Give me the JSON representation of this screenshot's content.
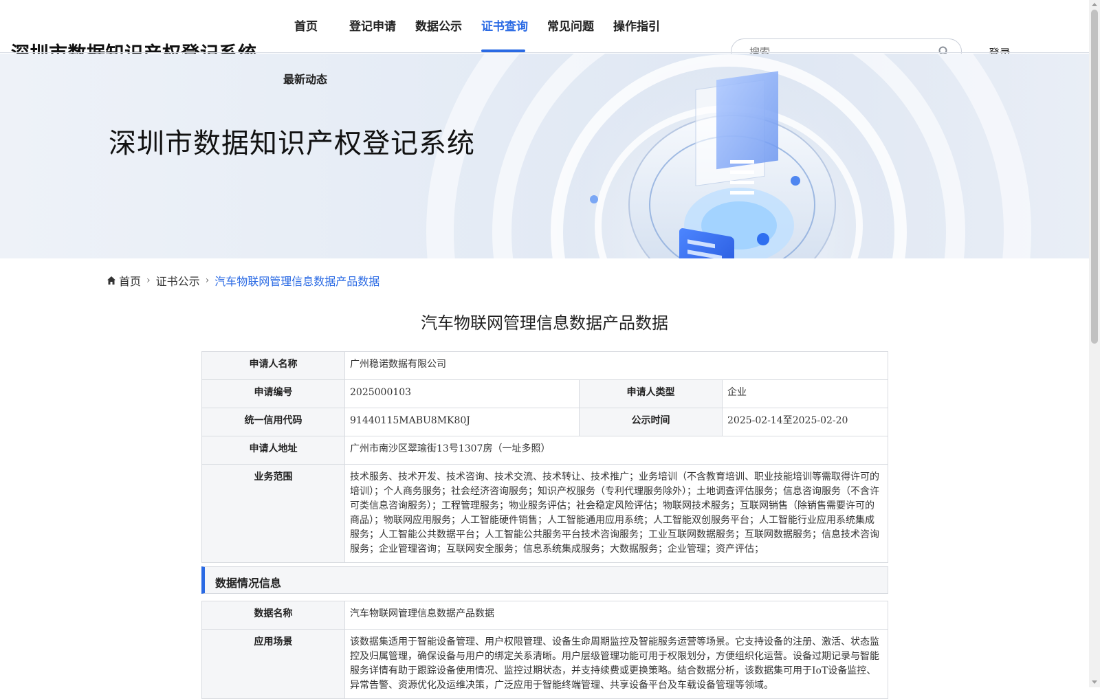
{
  "header": {
    "site_title": "深圳市数据知识产权登记系统",
    "nav": [
      {
        "label": "首页"
      },
      {
        "label": "登记申请"
      },
      {
        "label": "数据公示"
      },
      {
        "label": "证书查询"
      },
      {
        "label": "常见问题"
      },
      {
        "label": "操作指引"
      }
    ],
    "nav_row2": "最新动态",
    "active_nav": "证书查询",
    "search_placeholder": "搜索",
    "login_label": "登录"
  },
  "banner": {
    "title": "深圳市数据知识产权登记系统"
  },
  "breadcrumb": {
    "home": "首页",
    "level2": "证书公示",
    "current": "汽车物联网管理信息数据产品数据"
  },
  "page_title": "汽车物联网管理信息数据产品数据",
  "applicant": {
    "name_label": "申请人名称",
    "name": "广州稳诺数据有限公司",
    "app_no_label": "申请编号",
    "app_no": "2025000103",
    "type_label": "申请人类型",
    "type": "企业",
    "credit_code_label": "统一信用代码",
    "credit_code": "91440115MABU8MK80J",
    "publicity_label": "公示时间",
    "publicity": "2025-02-14至2025-02-20",
    "address_label": "申请人地址",
    "address": "广州市南沙区翠瑜街13号1307房（一址多照）",
    "scope_label": "业务范围",
    "scope": "技术服务、技术开发、技术咨询、技术交流、技术转让、技术推广；业务培训（不含教育培训、职业技能培训等需取得许可的培训）；个人商务服务；社会经济咨询服务；知识产权服务（专利代理服务除外）；土地调查评估服务；信息咨询服务（不含许可类信息咨询服务）；工程管理服务；物业服务评估；社会稳定风险评估；物联网技术服务；互联网销售（除销售需要许可的商品）；物联网应用服务；人工智能硬件销售；人工智能通用应用系统；人工智能双创服务平台；人工智能行业应用系统集成服务；人工智能公共数据平台；人工智能公共服务平台技术咨询服务；工业互联网数据服务；互联网数据服务；信息技术咨询服务；企业管理咨询；互联网安全服务；信息系统集成服务；大数据服务；企业管理；资产评估；"
  },
  "data_section": {
    "heading": "数据情况信息",
    "data_name_label": "数据名称",
    "data_name": "汽车物联网管理信息数据产品数据",
    "scenario_label": "应用场景",
    "scenario": "该数据集适用于智能设备管理、用户权限管理、设备生命周期监控及智能服务运营等场景。它支持设备的注册、激活、状态监控及归属管理，确保设备与用户的绑定关系清晰。用户层级管理功能可用于权限划分，方便组织化运营。设备过期记录与智能服务详情有助于跟踪设备使用情况、监控过期状态，并支持续费或更换策略。结合数据分析，该数据集可用于IoT设备监控、异常告警、资源优化及运维决策，广泛应用于智能终端管理、共享设备平台及车载设备管理等领域。"
  },
  "colors": {
    "accent": "#2a6ae4",
    "label_bg": "#f5f6f8",
    "border": "#d8dbe0"
  }
}
